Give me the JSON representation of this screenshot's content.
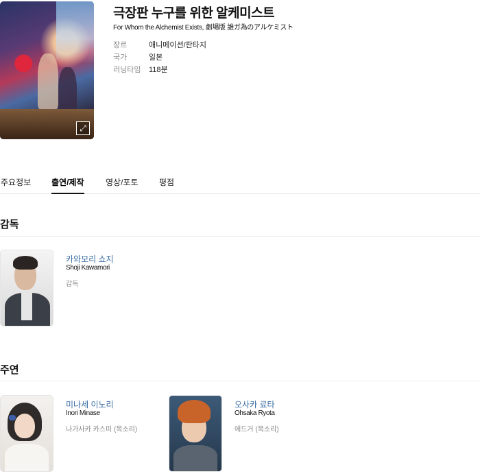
{
  "movie": {
    "title": "극장판 누구를 위한 알케미스트",
    "subtitle": "For Whom the Alchemist Exists, 劇場版 誰ガ為のアルケミスト",
    "meta": [
      {
        "key": "장르",
        "value": "애니메이션/판타지"
      },
      {
        "key": "국가",
        "value": "일본"
      },
      {
        "key": "러닝타임",
        "value": "118분"
      }
    ]
  },
  "icons": {
    "expand": "expand-icon"
  },
  "tabs": [
    {
      "label": "주요정보"
    },
    {
      "label": "출연/제작",
      "active": true
    },
    {
      "label": "영상/포토"
    },
    {
      "label": "평점"
    }
  ],
  "sections": {
    "director": {
      "title": "감독",
      "people": [
        {
          "name": "카와모리 쇼지",
          "name_en": "Shoji Kawamori",
          "role": "감독"
        }
      ]
    },
    "cast": {
      "title": "주연",
      "people": [
        {
          "name": "미나세 이노리",
          "name_en": "Inori Minase",
          "role": "나가사카 카스미 (목소리)"
        },
        {
          "name": "오사카 료타",
          "name_en": "Ohsaka Ryota",
          "role": "에드거 (목소리)"
        }
      ]
    }
  },
  "colors": {
    "link": "#3a6ea5",
    "muted": "#888888",
    "divider": "#e3e3e3"
  }
}
